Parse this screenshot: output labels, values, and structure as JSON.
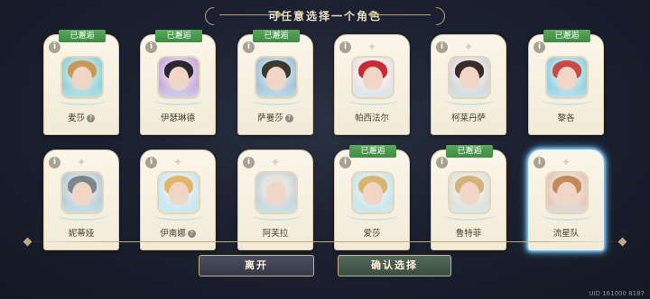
{
  "header": {
    "title": "可任意选择一个角色"
  },
  "badge_label": "已邂逅",
  "info_glyph": "i",
  "characters": [
    {
      "name": "麦莎",
      "met": true,
      "mark": "?",
      "hair": "#c79a55",
      "bg": "#8fd0d6"
    },
    {
      "name": "伊瑟琳德",
      "met": true,
      "mark": "",
      "hair": "#2a2730",
      "bg": "#c7a9d8"
    },
    {
      "name": "萨曼莎",
      "met": true,
      "mark": "?",
      "hair": "#3a3a30",
      "bg": "#9fc2d4"
    },
    {
      "name": "帕西法尔",
      "met": false,
      "mark": "",
      "hair": "#c82b34",
      "bg": "#e9e2e6"
    },
    {
      "name": "柯莱丹萨",
      "met": false,
      "mark": "",
      "hair": "#3a2a28",
      "bg": "#d6d6d6"
    },
    {
      "name": "黎各",
      "met": true,
      "mark": "",
      "hair": "#c94a45",
      "bg": "#8fd0e2"
    },
    {
      "name": "妮蒂娅",
      "met": false,
      "mark": "",
      "hair": "#7f858f",
      "bg": "#b8ccd6"
    },
    {
      "name": "伊南娜",
      "met": false,
      "mark": "?",
      "hair": "#e3b56a",
      "bg": "#cbe6ee"
    },
    {
      "name": "阿芙拉",
      "met": false,
      "mark": "",
      "hair": "#e6e4dc",
      "bg": "#c7d2d9"
    },
    {
      "name": "爱莎",
      "met": true,
      "mark": "",
      "hair": "#d9b46e",
      "bg": "#c9e4ea"
    },
    {
      "name": "鲁特菲",
      "met": true,
      "mark": "",
      "hair": "#d4b27a",
      "bg": "#e0e0d6"
    },
    {
      "name": "流星队",
      "met": false,
      "mark": "",
      "hair": "#c28b5a",
      "bg": "#e7c7b8",
      "selected": true
    }
  ],
  "buttons": {
    "leave": "离开",
    "confirm": "确认选择"
  },
  "uid": "UID 161000 8187",
  "colors": {
    "badge_green": "#4b9a4e",
    "selected_glow": "#6fc7ff",
    "accent_gold": "#c9b48a"
  }
}
